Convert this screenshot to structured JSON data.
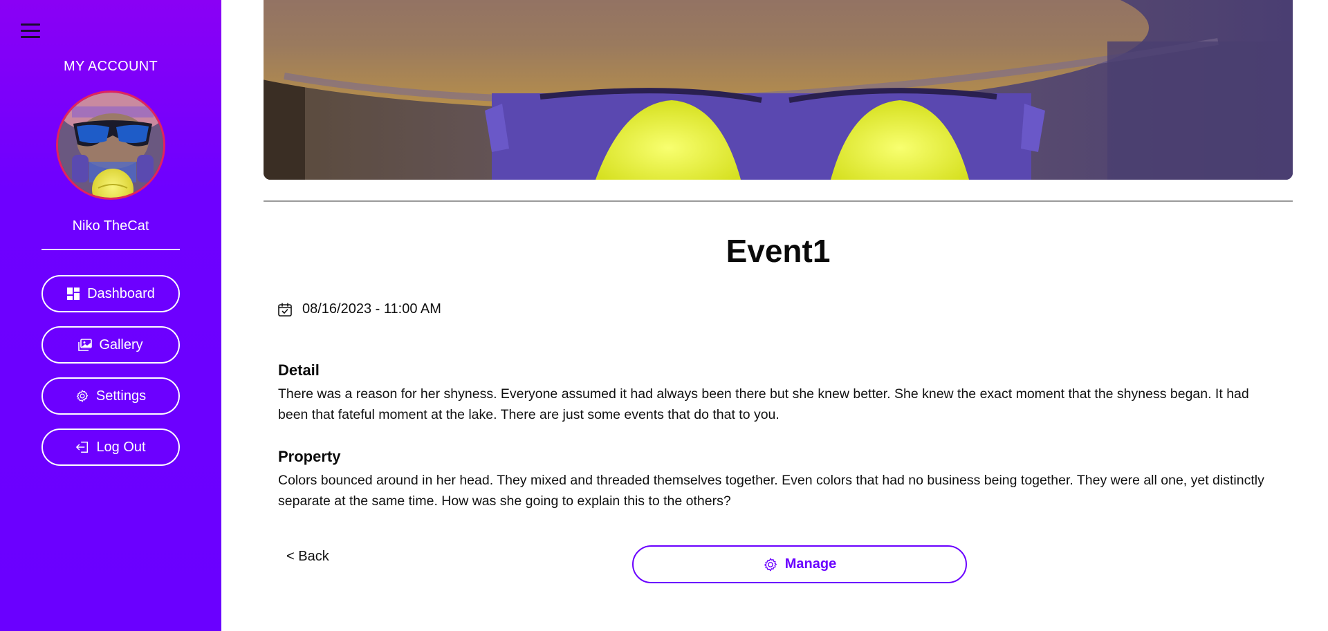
{
  "sidebar": {
    "account_title": "MY ACCOUNT",
    "user_name": "Niko TheCat",
    "nav": {
      "dashboard": "Dashboard",
      "gallery": "Gallery",
      "settings": "Settings",
      "logout": "Log Out"
    }
  },
  "event": {
    "title": "Event1",
    "datetime": "08/16/2023 - 11:00 AM",
    "detail_heading": "Detail",
    "detail_text": "There was a reason for her shyness. Everyone assumed it had always been there but she knew better. She knew the exact moment that the shyness began. It had been that fateful moment at the lake. There are just some events that do that to you.",
    "property_heading": "Property",
    "property_text": "Colors bounced around in her head. They mixed and threaded themselves together. Even colors that had no business being together. They were all one, yet distinctly separate at the same time. How was she going to explain this to the others?"
  },
  "actions": {
    "back": "< Back",
    "manage": "Manage"
  },
  "icons": [
    "hamburger-menu-icon",
    "dashboard-icon",
    "gallery-icon",
    "settings-gear-icon",
    "logout-icon",
    "calendar-check-icon",
    "gear-icon"
  ],
  "colors": {
    "sidebar_gradient_top": "#8a00f5",
    "sidebar_gradient_bottom": "#6a00ff",
    "accent": "#6a00ff",
    "avatar_border": "#e0245e"
  }
}
